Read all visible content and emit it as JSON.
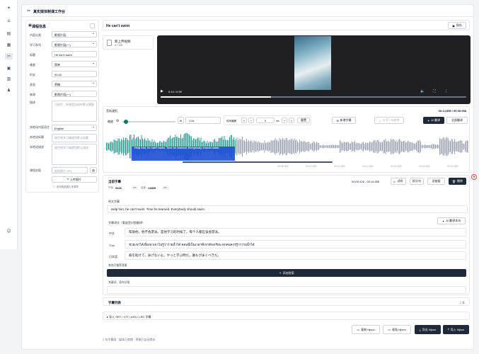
{
  "app": {
    "title": "真实媒体制课工作台"
  },
  "left": {
    "title": "课程信息",
    "fields": [
      {
        "label": "内容分类",
        "value": "影视片段"
      },
      {
        "label": "学习系列",
        "value": "影视片段(一)"
      },
      {
        "label": "标题",
        "value": "He can't swim"
      },
      {
        "label": "难度",
        "value": "简单"
      },
      {
        "label": "时长",
        "value": "00:40"
      },
      {
        "label": "状态",
        "value": "草稿"
      },
      {
        "label": "来源",
        "value": "影视片段(一)"
      }
    ],
    "desc_label": "描述",
    "desc_placeholder": "可留空，系统会自动补默认摘要",
    "lang_label": "本地化内容语言",
    "lang_value": "English",
    "local_title_label": "本地化标题",
    "local_title_placeholder": "留空则学习端使用默认标题",
    "local_desc_label": "本地化描述",
    "local_desc_placeholder": "留空则学习端使用默认描述",
    "cover_label": "课程封面",
    "cover_placeholder": "粘贴图片 URL",
    "upload_label": "上传图片",
    "paste_hint": "支持粘贴图片来源导"
  },
  "main": {
    "title": "He can't swim",
    "save_label": "保存",
    "file_name": "新上传视频",
    "file_size": "6.7 MB",
    "time_display": "0:14 / 0:39",
    "audio_label": "音轨波形",
    "range_display": "00:14.855 / 00:39.058",
    "zoom_label": "缩放",
    "zoom_value": "1.0x",
    "offset_label": "时间偏移",
    "offset_value": "0",
    "offset_unit": "ms",
    "reset_label": "重置",
    "add_sub_label": "新增字幕",
    "merge_label": "与下一句合并",
    "ai_translate_label": "AI 翻译",
    "all_translate_label": "全部翻译",
    "wave_caption": "Help him, he can't swim. Time he learned. Everybody should swim.",
    "ticks": [
      "00:08.000",
      "00:10.000",
      "00:12.000",
      "00:14.000",
      "00:16.000",
      "00:18.000",
      "00:20.000"
    ]
  },
  "subtitle": {
    "title": "当前字幕",
    "range": "00:09.426 - 00:14.855",
    "start_label": "开始",
    "start_value": "9426",
    "end_label": "结束",
    "end_value": "14855",
    "unit": "ms",
    "try_label": "试听",
    "split_label": "拆分句",
    "settings_label": "设链接",
    "delete_label": "删除",
    "original_label": "原文字幕",
    "original_text": "Help him, he can't swim. Time he learned. Everybody should swim.",
    "translation_label": "字幕译文（看谁是对照翻译）",
    "ai_line_label": "AI 翻译本句",
    "translations": [
      {
        "lang": "中文",
        "text": "帮助他，他不会游泳。是他学习的时候了。每个人都应该会游泳。"
      },
      {
        "lang": "Thai",
        "text": "ช่วยเขาได้เพื่อเขาเขาไม่รู้ว่าว่ายน้ำได้ ตอนนี้เป็นเวลาที่เขาต้องเรียน ทุกคนควรรู้ว่าว่ายน้ำได้"
      },
      {
        "lang": "日本語",
        "text": "彼を助けて、泳げないよ。やっと学ぶ時だ。誰もが泳ぐべきだ。"
      }
    ],
    "other_label": "其他可推荐答案",
    "add_answer_label": "添加答案",
    "keyword_label": "关键词、语句分组",
    "list_title": "字幕列表",
    "list_count": "2 条",
    "import_label": "导入 SRT / VTT / ASS / LRC 字幕"
  },
  "footer": {
    "status": "2 句字幕段 · 媒体已就绪 · 草稿已自动保存",
    "copy_json": "复制 hljson",
    "paste_json": "粘贴 hljson",
    "export_json": "导出 hljson",
    "import_json": "导入 hljson"
  }
}
